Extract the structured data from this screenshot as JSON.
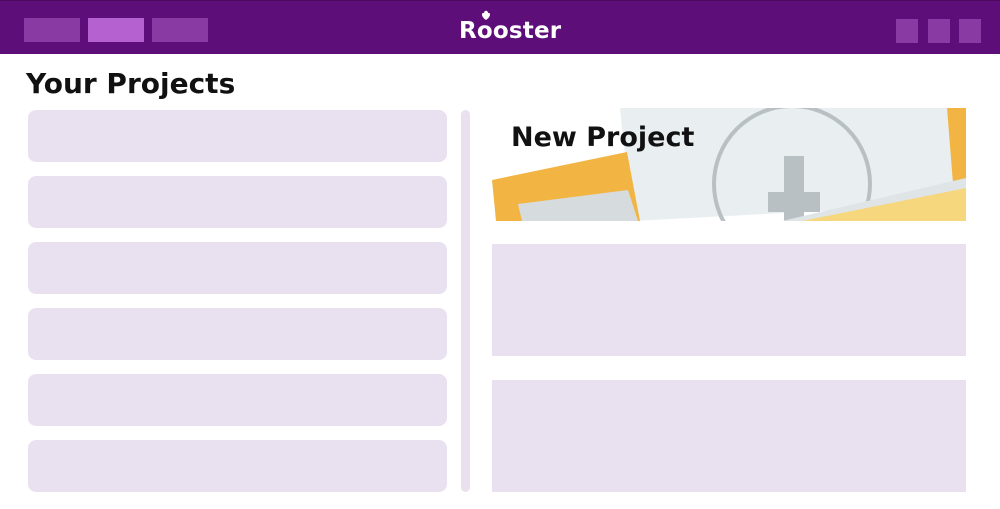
{
  "app": {
    "logo_text": "Rooster"
  },
  "page": {
    "title": "Your Projects"
  },
  "projects": {
    "rows": 6
  },
  "new_project": {
    "label": "New Project"
  },
  "colors": {
    "topbar": "#5e0e78",
    "tab": "#8a3aa3",
    "tab_active": "#b561cf",
    "placeholder": "#e9e1ef",
    "folder_orange": "#f2b543",
    "folder_light": "#f6d77d",
    "paper": "#e9eef1",
    "plus_gray": "#b8c0c3"
  },
  "icons": {
    "logo_mark": "rooster-comb-icon",
    "new_project": "plus-icon"
  }
}
